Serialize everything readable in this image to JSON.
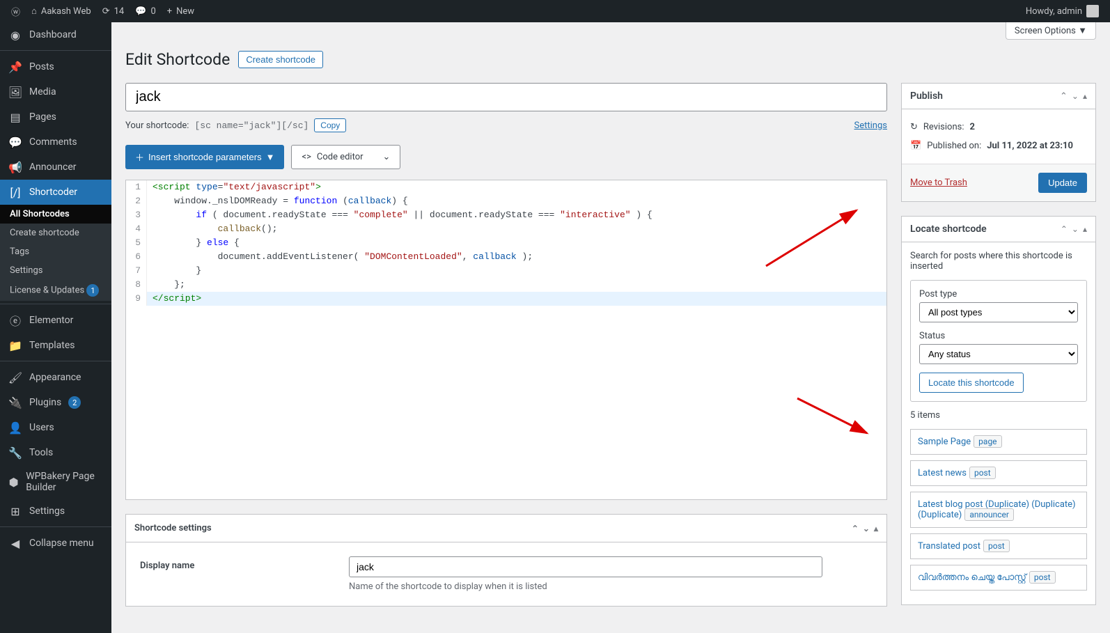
{
  "adminbar": {
    "site_name": "Aakash Web",
    "updates": "14",
    "comments": "0",
    "new": "New",
    "howdy": "Howdy, admin"
  },
  "sidebar": {
    "items": [
      {
        "label": "Dashboard"
      },
      {
        "label": "Posts"
      },
      {
        "label": "Media"
      },
      {
        "label": "Pages"
      },
      {
        "label": "Comments"
      },
      {
        "label": "Announcer"
      },
      {
        "label": "Shortcoder"
      },
      {
        "label": "Elementor"
      },
      {
        "label": "Templates"
      },
      {
        "label": "Appearance"
      },
      {
        "label": "Plugins"
      },
      {
        "label": "Users"
      },
      {
        "label": "Tools"
      },
      {
        "label": "WPBakery Page Builder"
      },
      {
        "label": "Settings"
      },
      {
        "label": "Collapse menu"
      }
    ],
    "submenu": [
      {
        "label": "All Shortcodes"
      },
      {
        "label": "Create shortcode"
      },
      {
        "label": "Tags"
      },
      {
        "label": "Settings"
      },
      {
        "label": "License & Updates"
      }
    ],
    "license_badge": "1",
    "plugins_badge": "2"
  },
  "screen_options": "Screen Options",
  "heading": {
    "title": "Edit Shortcode",
    "create": "Create shortcode"
  },
  "title_input": "jack",
  "shortcode_row": {
    "label": "Your shortcode:",
    "code": "[sc name=\"jack\"][/sc]",
    "copy": "Copy",
    "settings": "Settings"
  },
  "toolbar": {
    "insert": "Insert shortcode parameters",
    "editor": "Code editor"
  },
  "code_lines": [
    "1",
    "2",
    "3",
    "4",
    "5",
    "6",
    "7",
    "8",
    "9"
  ],
  "publish": {
    "title": "Publish",
    "revisions_label": "Revisions:",
    "revisions_count": "2",
    "published_label": "Published on:",
    "published_date": "Jul 11, 2022 at 23:10",
    "trash": "Move to Trash",
    "update": "Update"
  },
  "locate": {
    "title": "Locate shortcode",
    "desc": "Search for posts where this shortcode is inserted",
    "post_type_label": "Post type",
    "post_type_value": "All post types",
    "status_label": "Status",
    "status_value": "Any status",
    "button": "Locate this shortcode",
    "count": "5 items",
    "results": [
      {
        "title": "Sample Page",
        "type": "page"
      },
      {
        "title": "Latest news",
        "type": "post"
      },
      {
        "title": "Latest blog post (Duplicate) (Duplicate) (Duplicate)",
        "type": "announcer"
      },
      {
        "title": "Translated post",
        "type": "post"
      },
      {
        "title": "വിവർത്തനം ചെയ്ത പോസ്റ്റ്",
        "type": "post"
      }
    ]
  },
  "settings_box": {
    "title": "Shortcode settings",
    "display_label": "Display name",
    "display_value": "jack",
    "display_desc": "Name of the shortcode to display when it is listed"
  }
}
